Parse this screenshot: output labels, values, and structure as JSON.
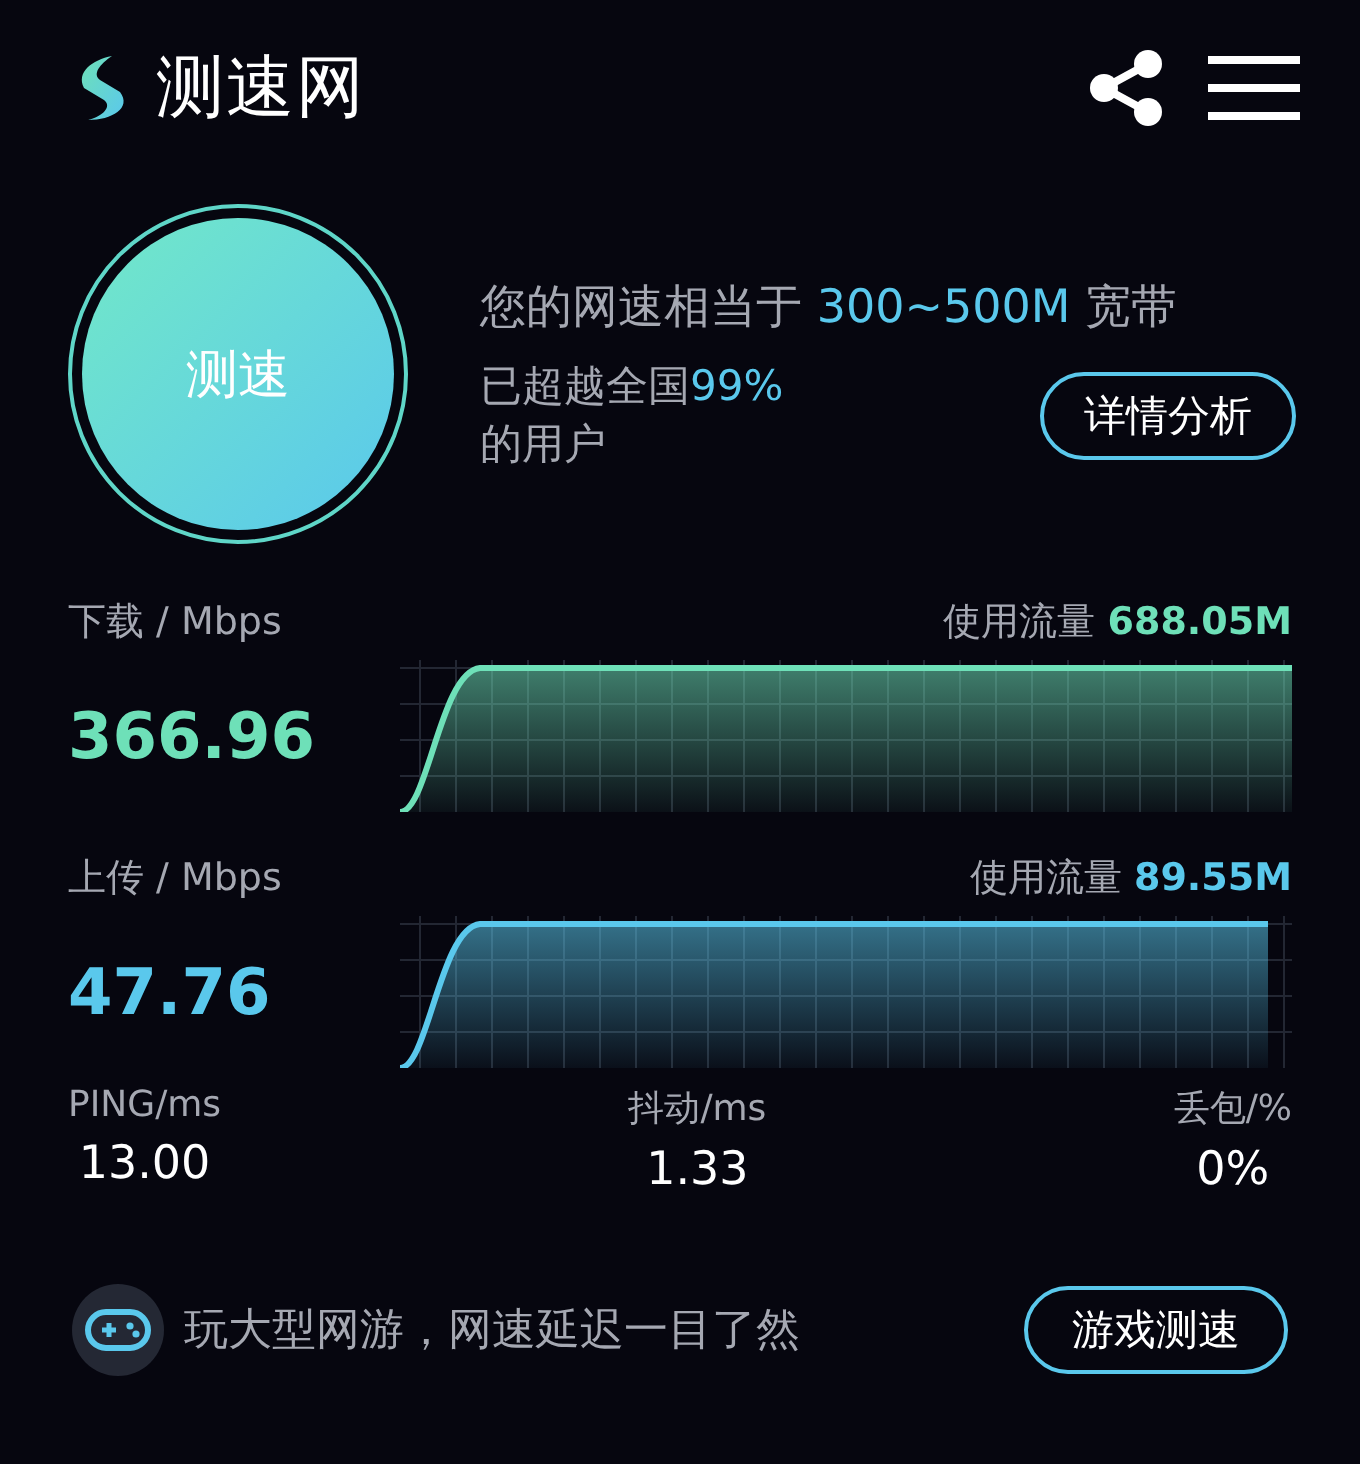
{
  "header": {
    "title": "测速网"
  },
  "summary": {
    "button": "测速",
    "speed_before": "您的网速相当于 ",
    "speed_highlight": "300~500M",
    "speed_after": " 宽带",
    "rank_before": "已超越全国",
    "rank_highlight": "99%",
    "rank_after": "的用户",
    "detail_button": "详情分析"
  },
  "sections": [
    {
      "label": "下载 / Mbps",
      "value": "366.96",
      "usage_label": "使用流量",
      "usage_value": "688.05M",
      "color": "#6ee0b8",
      "kind": "full"
    },
    {
      "label": "上传 / Mbps",
      "value": "47.76",
      "usage_label": "使用流量",
      "usage_value": "89.55M",
      "color": "#5ac8ec",
      "kind": "partial"
    }
  ],
  "stats": [
    {
      "label": "PING/ms",
      "value": "13.00"
    },
    {
      "label": "抖动/ms",
      "value": "1.33"
    },
    {
      "label": "丢包/%",
      "value": "0%"
    }
  ],
  "promo": {
    "text": "玩大型网游，网速延迟一目了然",
    "button": "游戏测速"
  }
}
